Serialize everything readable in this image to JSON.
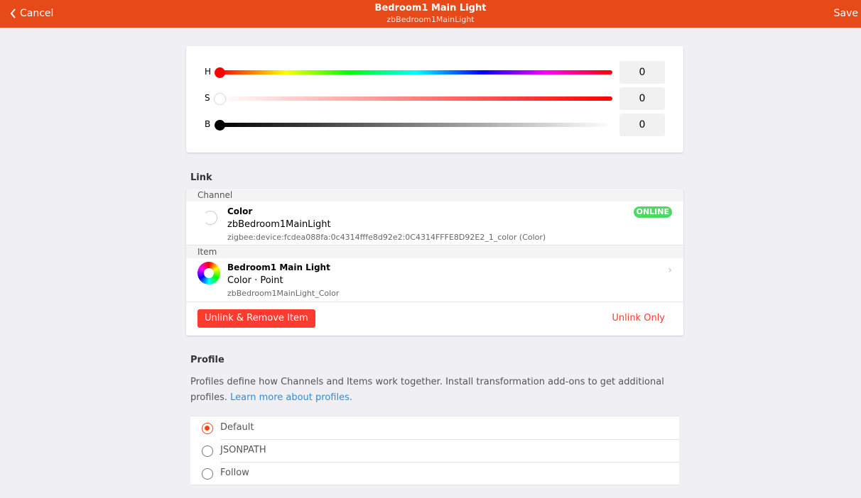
{
  "navbar": {
    "back_label": "Cancel",
    "title": "Bedroom1 Main Light",
    "subtitle": "zbBedroom1MainLight",
    "save_label": "Save",
    "color": "#e64a19"
  },
  "hsb": {
    "h": {
      "label": "H",
      "value": "0"
    },
    "s": {
      "label": "S",
      "value": "0"
    },
    "b": {
      "label": "B",
      "value": "0"
    }
  },
  "link": {
    "title": "Link",
    "channel_header": "Channel",
    "channel": {
      "title": "Color",
      "subtitle": "zbBedroom1MainLight",
      "footer": "zigbee:device:fcdea088fa:0c4314fffe8d92e2:0C4314FFFE8D92E2_1_color (Color)",
      "badge": "ONLINE"
    },
    "item_header": "Item",
    "item": {
      "title": "Bedroom1 Main Light",
      "subtitle": "Color · Point",
      "footer": "zbBedroom1MainLight_Color"
    },
    "unlink_remove_label": "Unlink & Remove Item",
    "unlink_only_label": "Unlink Only"
  },
  "profile": {
    "title": "Profile",
    "description": "Profiles define how Channels and Items work together. Install transformation add-ons to get additional profiles.",
    "learn_more": "Learn more about profiles.",
    "options": [
      {
        "label": "Default",
        "selected": true
      },
      {
        "label": "JSONPATH",
        "selected": false
      },
      {
        "label": "Follow",
        "selected": false
      }
    ]
  }
}
